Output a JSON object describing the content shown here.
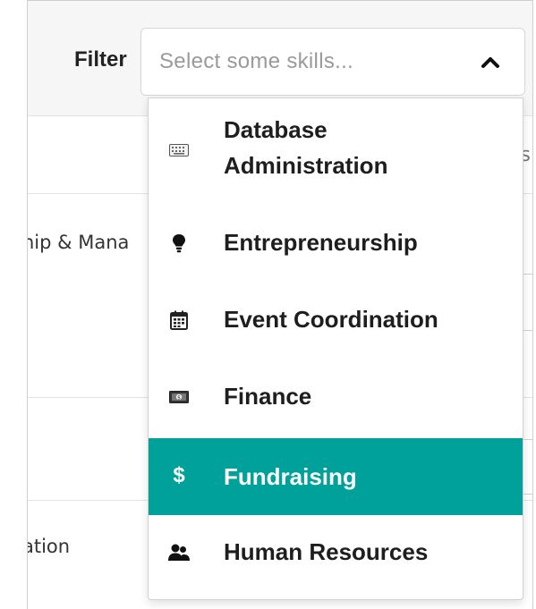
{
  "filter": {
    "label": "Filter",
    "placeholder": "Select some skills...",
    "expanded": true
  },
  "background": {
    "row1_text": "hip & Mana",
    "row3_text": "ation",
    "header_fragment": "s"
  },
  "dropdown": {
    "options": [
      {
        "label_line1": "Database",
        "label_line2": "Administration",
        "icon": "keyboard-icon"
      },
      {
        "label": "Entrepreneurship",
        "icon": "lightbulb-icon"
      },
      {
        "label": "Event Coordination",
        "icon": "calendar-icon"
      },
      {
        "label": "Finance",
        "icon": "money-bill-icon"
      },
      {
        "label": "Fundraising",
        "icon": "dollar-icon",
        "highlighted": true
      },
      {
        "label": "Human Resources",
        "icon": "users-icon"
      }
    ],
    "highlight_color": "#00a19a"
  }
}
